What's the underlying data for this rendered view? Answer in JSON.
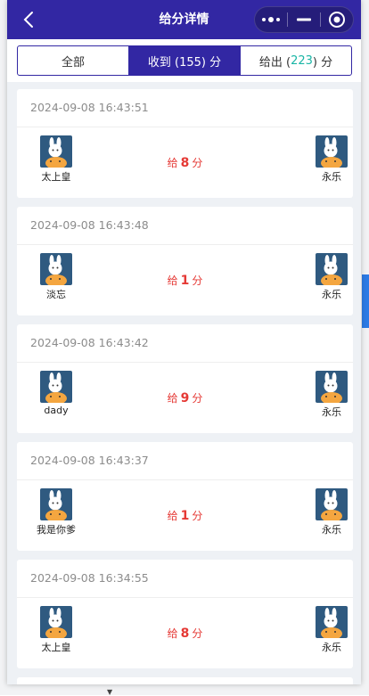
{
  "nav": {
    "title": "给分详情",
    "back_icon": "chevron-left-icon",
    "menu_icon": "more-dots-icon",
    "minimize_icon": "minimize-icon",
    "close_icon": "target-close-icon"
  },
  "tabs": {
    "all": "全部",
    "received": "收到 (155) 分",
    "given_prefix": "给出 (",
    "given_count": "223",
    "given_suffix": ") 分"
  },
  "colors": {
    "brand": "#3227a3",
    "score_red": "#e53935",
    "count_green": "#19b5a5",
    "avatar_bg": "#2f5a80"
  },
  "records": [
    {
      "time": "2024-09-08 16:43:51",
      "from": "太上皇",
      "to": "永乐",
      "score_prefix": "给",
      "score": "8",
      "score_suffix": "分"
    },
    {
      "time": "2024-09-08 16:43:48",
      "from": "淡忘",
      "to": "永乐",
      "score_prefix": "给",
      "score": "1",
      "score_suffix": "分"
    },
    {
      "time": "2024-09-08 16:43:42",
      "from": "dady",
      "to": "永乐",
      "score_prefix": "给",
      "score": "9",
      "score_suffix": "分"
    },
    {
      "time": "2024-09-08 16:43:37",
      "from": "我是你爹",
      "to": "永乐",
      "score_prefix": "给",
      "score": "1",
      "score_suffix": "分"
    },
    {
      "time": "2024-09-08 16:34:55",
      "from": "太上皇",
      "to": "永乐",
      "score_prefix": "给",
      "score": "8",
      "score_suffix": "分"
    }
  ]
}
